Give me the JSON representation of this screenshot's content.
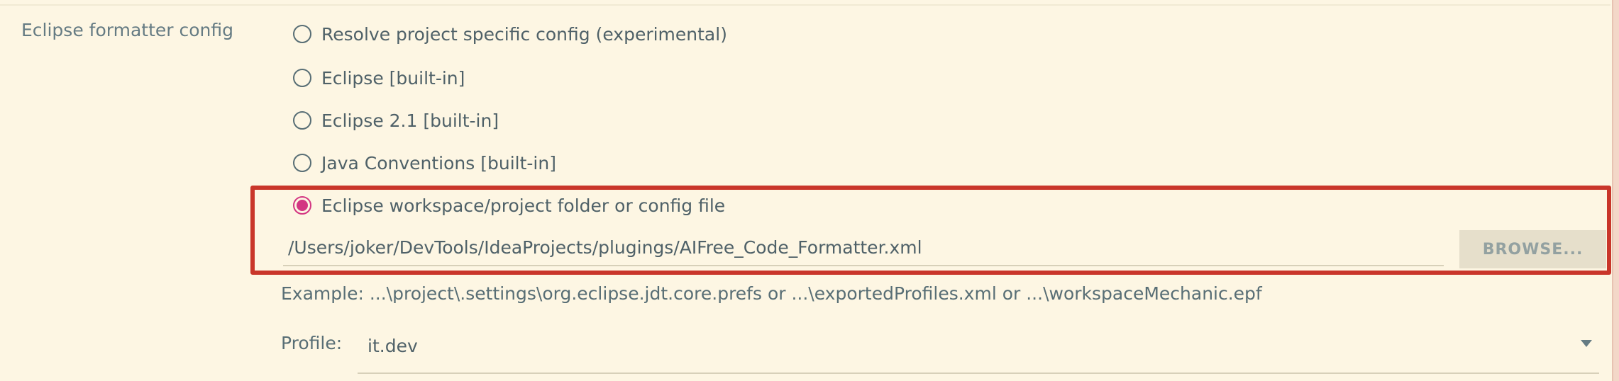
{
  "section": {
    "label": "Eclipse formatter config"
  },
  "radios": [
    {
      "label": "Resolve project specific config (experimental)",
      "checked": false
    },
    {
      "label": "Eclipse [built-in]",
      "checked": false
    },
    {
      "label": "Eclipse 2.1 [built-in]",
      "checked": false
    },
    {
      "label": "Java Conventions [built-in]",
      "checked": false
    },
    {
      "label": "Eclipse workspace/project folder or config file",
      "checked": true
    }
  ],
  "config_path": {
    "value": "/Users/joker/DevTools/IdeaProjects/plugings/AIFree_Code_Formatter.xml"
  },
  "browse_button": {
    "label": "BROWSE..."
  },
  "example": {
    "text": "Example: ...\\project\\.settings\\org.eclipse.jdt.core.prefs or ...\\exportedProfiles.xml or ...\\workspaceMechanic.epf"
  },
  "profile": {
    "label": "Profile:",
    "selected": "it.dev"
  },
  "colors": {
    "background": "#fdf6e3",
    "accent": "#d33682",
    "highlight_border": "#c9362a",
    "text": "#586e75"
  }
}
